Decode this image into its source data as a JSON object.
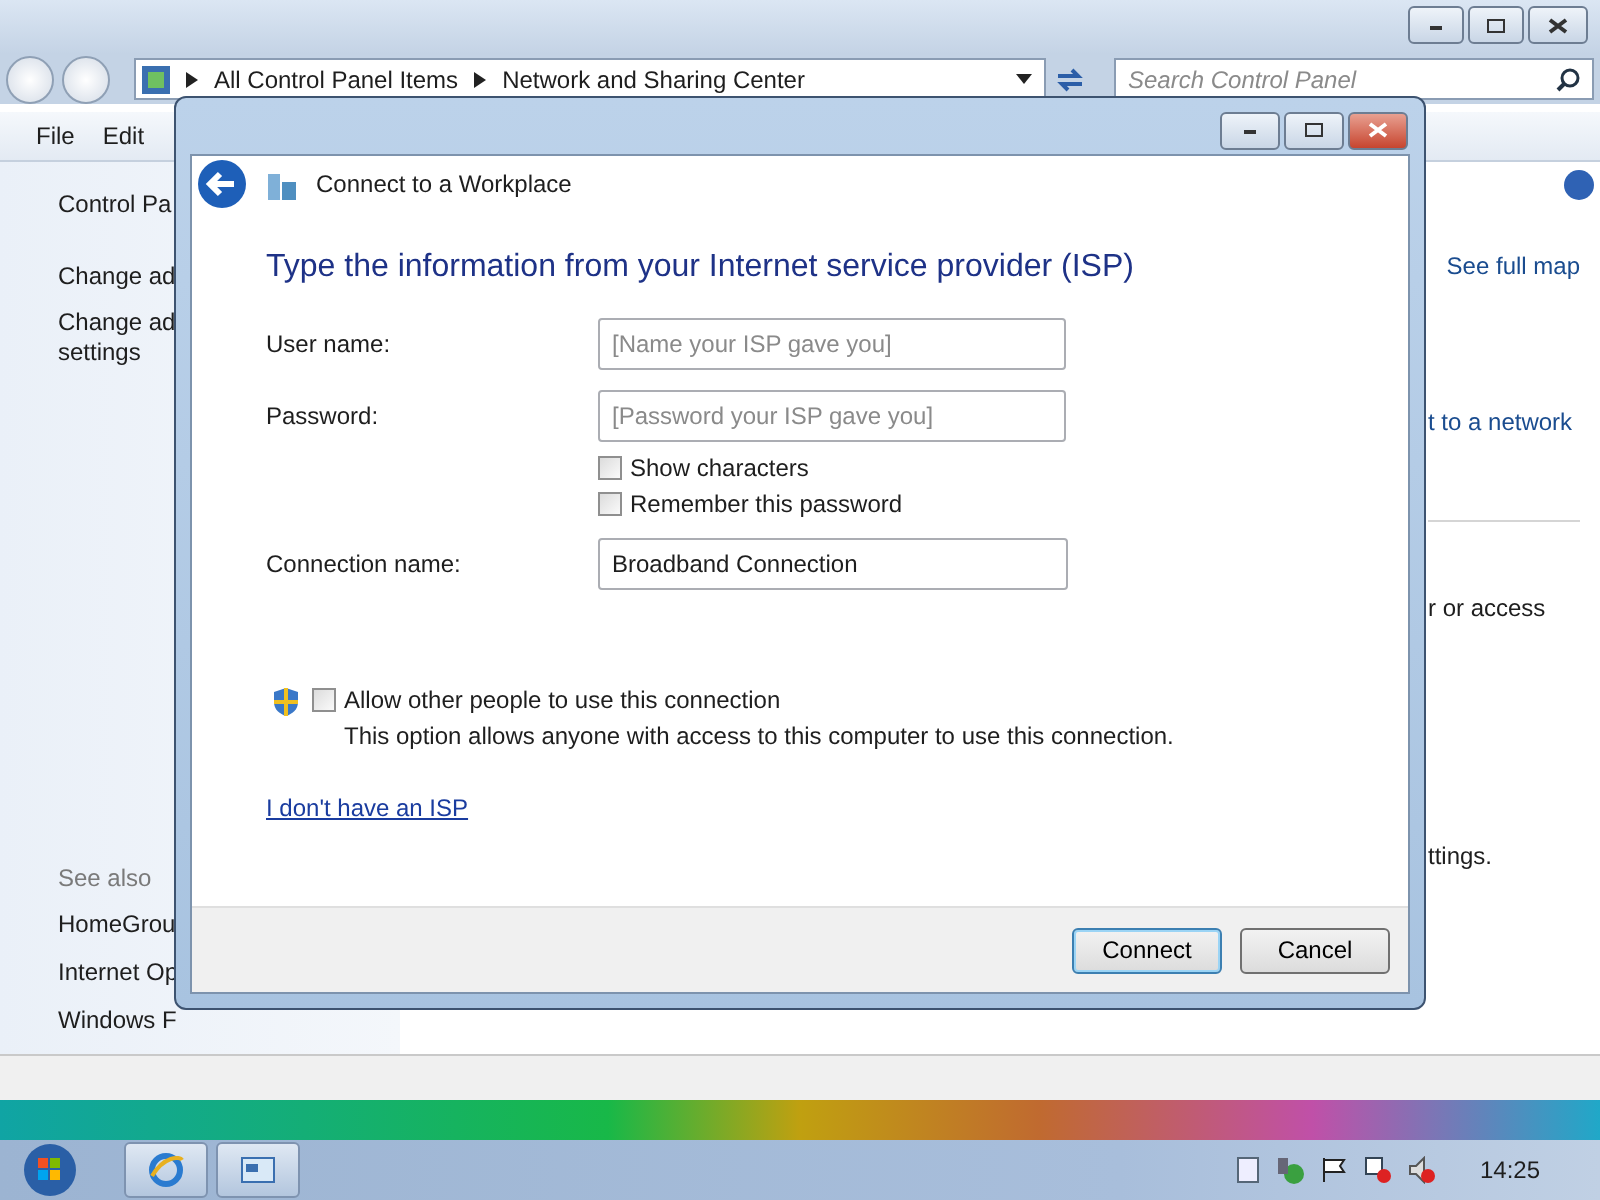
{
  "explorer": {
    "address": {
      "crumbs": [
        "All Control Panel Items",
        "Network and Sharing Center"
      ]
    },
    "search": {
      "placeholder": "Search Control Panel"
    },
    "menu": [
      "File",
      "Edit"
    ],
    "sidebar": {
      "items": [
        {
          "lines": [
            "Control Pa"
          ]
        },
        {
          "lines": [
            "Change ad"
          ]
        },
        {
          "lines": [
            "Change ad",
            "settings"
          ]
        }
      ],
      "see_also": {
        "heading": "See also",
        "items": [
          "HomeGrou",
          "Internet Op",
          "Windows F"
        ]
      }
    },
    "main_right": [
      {
        "kind": "link",
        "text": "See full map"
      },
      {
        "kind": "link",
        "text": "t to a network"
      },
      {
        "kind": "text",
        "text": "r or access"
      },
      {
        "kind": "text",
        "text": "ttings."
      }
    ]
  },
  "dialog": {
    "title": "Connect to a Workplace",
    "heading": "Type the information from your Internet service provider (ISP)",
    "fields": [
      {
        "label": "User name:",
        "placeholder": "[Name your ISP gave you]"
      },
      {
        "label": "Password:",
        "placeholder": "[Password your ISP gave you]"
      }
    ],
    "options": [
      {
        "label": "Show characters",
        "checked": false
      },
      {
        "label": "Remember this password",
        "checked": false
      }
    ],
    "connection": {
      "label": "Connection name:",
      "value": "Broadband Connection"
    },
    "share": {
      "label": "Allow other people to use this connection",
      "checked": false,
      "note": "This option allows anyone with access to this computer to use this connection."
    },
    "link": "I don't have an ISP",
    "buttons": [
      {
        "label": "Connect",
        "default": true
      },
      {
        "label": "Cancel",
        "default": false
      }
    ]
  },
  "taskbar": {
    "clock": "14:25"
  }
}
